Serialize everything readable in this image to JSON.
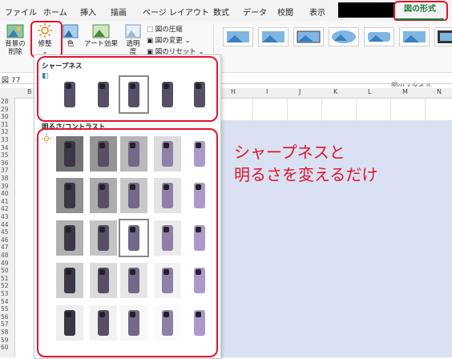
{
  "tabs": [
    "ファイル",
    "ホーム",
    "挿入",
    "描画",
    "ページ レイアウト",
    "数式",
    "データ",
    "校閲",
    "表示",
    "図の形式"
  ],
  "ribbon": {
    "remove_bg": "背景の削除",
    "corrections": "修整",
    "color": "色",
    "artistic": "アート効果",
    "transparency": "透明度",
    "compress": "図の圧縮",
    "change": "図の変更",
    "reset": "図のリセット",
    "styles_label": "図のスタイル"
  },
  "namebox": "図 77",
  "columns": [
    "B",
    "H",
    "I",
    "J",
    "K",
    "L",
    "M",
    "N"
  ],
  "rows": [
    "28",
    "29",
    "30",
    "31",
    "32",
    "33",
    "34",
    "35",
    "36",
    "37",
    "38",
    "39",
    "40",
    "41",
    "42",
    "43",
    "44",
    "45",
    "46",
    "47",
    "48",
    "49",
    "50",
    "51",
    "52",
    "53",
    "54",
    "55",
    "56",
    "57",
    "58",
    "59",
    "60"
  ],
  "dropdown": {
    "sharpness_title": "シャープネス",
    "brightness_title": "明るさ/コントラスト"
  },
  "callout": {
    "line1": "シャープネスと",
    "line2": "明るさを変えるだけ"
  },
  "colors": {
    "accent_green": "#1e7a3f",
    "highlight_red": "#e0162b",
    "sheet_blue": "#d9e1f2",
    "phone_purple": "#5a4f6e"
  },
  "grid": {
    "sharpness_count": 5,
    "brightness_rows": 5,
    "brightness_cols": 5
  }
}
